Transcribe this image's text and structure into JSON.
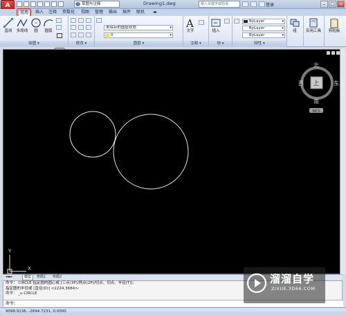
{
  "titlebar": {
    "app_icon": "A",
    "workspace": "草图与注释",
    "doc_title": "Drawing1.dwg",
    "search_placeholder": "键入关键字或短语",
    "login": "登录"
  },
  "tabs": [
    "常用",
    "插入",
    "注释",
    "参数化",
    "视图",
    "管理",
    "输出",
    "插件",
    "联机"
  ],
  "ribbon": {
    "draw": {
      "tools": [
        "直线",
        "多段线",
        "圆",
        "圆弧"
      ],
      "footer": "绘图 ▾"
    },
    "modify": {
      "footer": "修改 ▾"
    },
    "layers": {
      "state": "未保存的图层状态",
      "layer": "0",
      "footer": "图层 ▾"
    },
    "annotation": {
      "tool": "文字",
      "footer": "注释 ▾"
    },
    "block": {
      "tool": "插入",
      "footer": "块 ▾"
    },
    "properties": {
      "color": "ByLayer",
      "linetype": "ByLayer",
      "lineweight": "ByLayer",
      "footer": "特性 ▾"
    },
    "group": {
      "tool": "组"
    },
    "utilities": {
      "tool": "实用工具"
    },
    "clipboard": {
      "tool": "剪贴板"
    }
  },
  "viewcube": {
    "north": "北",
    "south": "南",
    "east": "东",
    "west": "西",
    "face": "上",
    "wcs": "WCS"
  },
  "ucs": {
    "x": "X",
    "y": "Y"
  },
  "model_tabs": [
    "模型",
    "布局1",
    "布局2"
  ],
  "command": {
    "lines": [
      "命令： CIRCLE 指定圆的圆心或 [三点(3P)/两点(2P)/切点、切点、半径(T)]:",
      "指定圆的半径或 [直径(D)] <2224.3684>:",
      "命令： _u CIRCLE"
    ],
    "prompt": "命令："
  },
  "status": {
    "coords": "9098.9136, -2694.7231, 0.0000"
  },
  "watermark": {
    "brand": "溜溜自学",
    "url": "ZIXUE.3D66.COM"
  },
  "colors": {
    "accent": "#e0261b",
    "canvas": "#000000",
    "ribbon": "#dbe4f2"
  }
}
